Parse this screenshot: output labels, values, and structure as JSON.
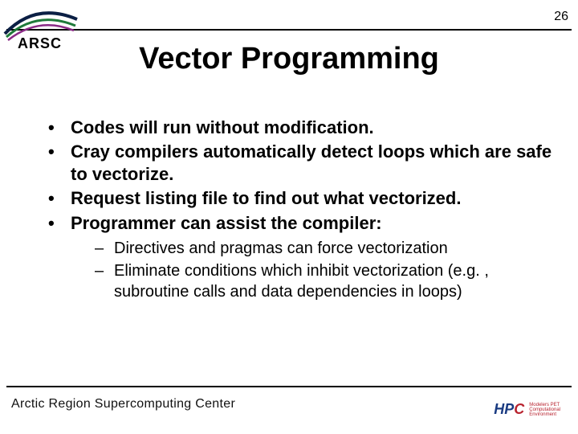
{
  "page_number": "26",
  "logo": {
    "text": "ARSC"
  },
  "title": "Vector Programming",
  "bullets": [
    "Codes will run without modification.",
    "Cray compilers automatically detect loops which are safe to vectorize.",
    "Request listing file to find out what vectorized.",
    "Programmer can assist the compiler:"
  ],
  "subbullets": [
    "Directives and pragmas can force vectorization",
    "Eliminate conditions which inhibit vectorization  (e.g. , subroutine calls and data dependencies in loops)"
  ],
  "footer": {
    "org": "Arctic Region Supercomputing Center",
    "hpc_prefix": "HP",
    "hpc_suffix": "C",
    "hpc_sub1": "Modelers PET",
    "hpc_sub2": "Computational",
    "hpc_sub3": "Environment"
  }
}
